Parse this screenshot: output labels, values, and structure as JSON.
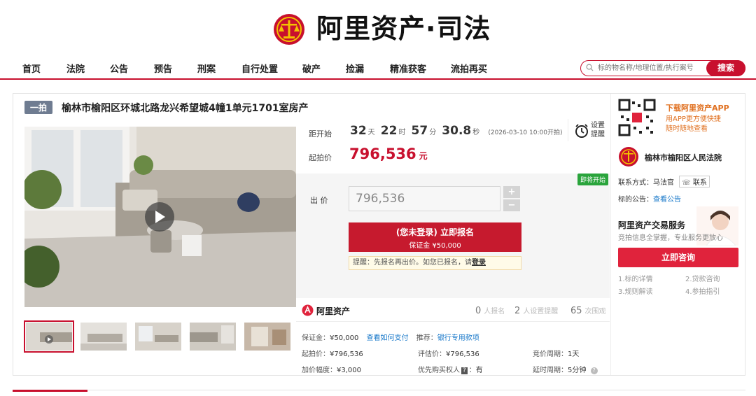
{
  "header": {
    "logo_text": "阿里资产·司法",
    "colors": {
      "brand_red": "#c8102e",
      "gold": "#f3c200"
    }
  },
  "nav": {
    "items": [
      "首页",
      "法院",
      "公告",
      "预告",
      "刑案",
      "自行处置",
      "破产",
      "捡漏",
      "精准获客",
      "流拍再买"
    ]
  },
  "search": {
    "placeholder": "标的物名称/地理位置/执行案号",
    "button_label": "搜索"
  },
  "item": {
    "round_tag": "一拍",
    "title": "榆林市榆阳区环城北路龙兴希望城4幢1单元1701室房产"
  },
  "countdown": {
    "label": "距开始",
    "days": "32",
    "days_unit": "天",
    "hours": "22",
    "hours_unit": "时",
    "minutes": "57",
    "minutes_unit": "分",
    "seconds": "30.8",
    "seconds_unit": "秒",
    "start_note": "(2026-03-10 10:00开拍)"
  },
  "reminder": {
    "label": "设置提醒"
  },
  "start_price": {
    "label": "起拍价",
    "value": "796,536",
    "unit": "元"
  },
  "bid": {
    "soon_tag": "即将开始",
    "label": "出  价",
    "input_value": "796,536",
    "plus": "+",
    "minus": "−",
    "signup_main": "(您未登录) 立即报名",
    "signup_sub": "保证金 ¥50,000",
    "tip_text": "提醒：先报名再出价。如您已报名，请",
    "tip_link": "登录"
  },
  "brand": {
    "name": "阿里资产",
    "stats": [
      {
        "value": "0",
        "label": "人报名"
      },
      {
        "value": "2",
        "label": "人设置提醒"
      },
      {
        "value": "65",
        "label": "次围观"
      }
    ]
  },
  "details": {
    "deposit_label": "保证金：",
    "deposit_value": "¥50,000",
    "deposit_link": "查看如何支付",
    "recommend_label": "推荐：",
    "recommend_link": "银行专用款项",
    "start_label": "起拍价：",
    "start_value": "¥796,536",
    "eval_label": "评估价：",
    "eval_value": "¥796,536",
    "cycle_label": "竞价周期：",
    "cycle_value": "1天",
    "increment_label": "加价幅度：",
    "increment_value": "¥3,000",
    "priority_label": "优先购买权人",
    "priority_value": "有",
    "delay_label": "延时周期：",
    "delay_value": "5分钟"
  },
  "sidebar": {
    "app_title": "下载阿里资产APP",
    "app_sub1": "用APP更方便快捷",
    "app_sub2": "随时随地查看",
    "court_name": "榆林市榆阳区人民法院",
    "contact_label": "联系方式：",
    "contact_name": "马法官",
    "contact_button": "联系",
    "notice_label": "标的公告：",
    "notice_link": "查看公告",
    "service_title": "阿里资产交易服务",
    "service_sub": "竞拍信息全掌握，专业服务更放心",
    "consult_button": "立即咨询",
    "links": [
      "1.标的详情",
      "2.贷款咨询",
      "3.规则解读",
      "4.参拍指引"
    ]
  }
}
